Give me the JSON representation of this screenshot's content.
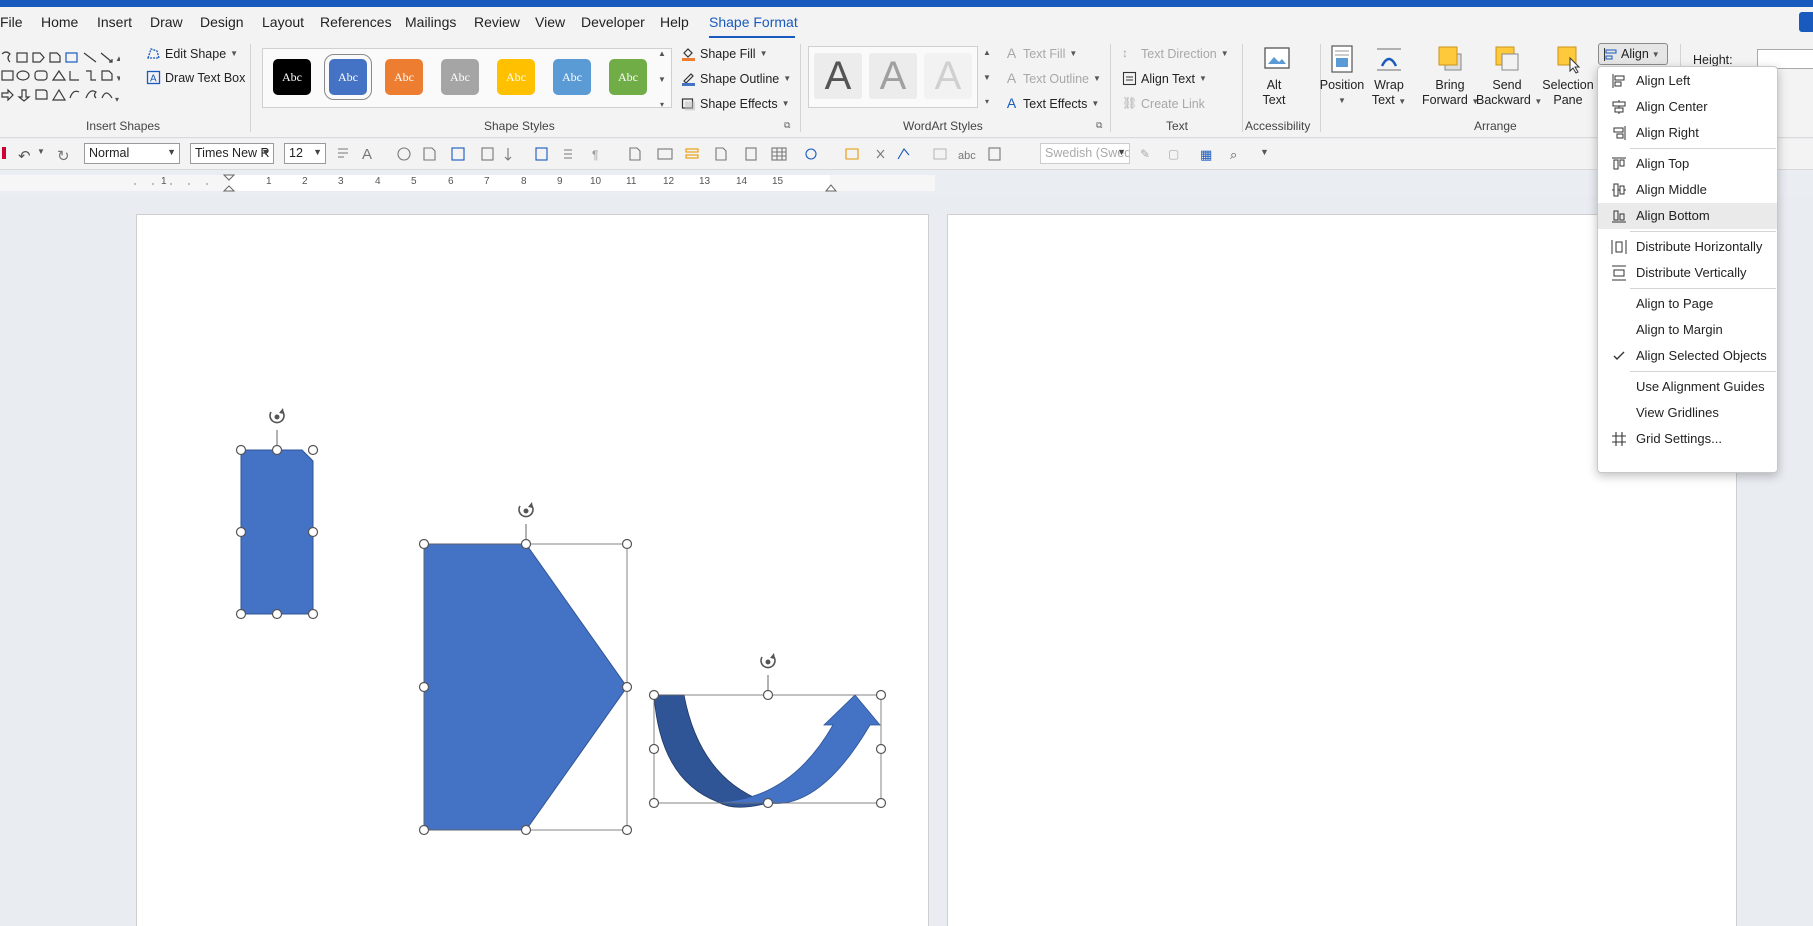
{
  "menu": {
    "tabs": [
      "File",
      "Home",
      "Insert",
      "Draw",
      "Design",
      "Layout",
      "References",
      "Mailings",
      "Review",
      "View",
      "Developer",
      "Help",
      "Shape Format"
    ],
    "active_tab": "Shape Format"
  },
  "ribbon": {
    "insert_shapes": {
      "label": "Insert Shapes",
      "edit_shape": "Edit Shape",
      "draw_text_box": "Draw Text Box"
    },
    "shape_styles": {
      "label": "Shape Styles",
      "swatch_text": "Abc",
      "swatch_colors": [
        "#000000",
        "#4472c4",
        "#ed7d31",
        "#a5a5a5",
        "#ffc000",
        "#5b9bd5",
        "#70ad47"
      ],
      "shape_fill": "Shape Fill",
      "shape_outline": "Shape Outline",
      "shape_effects": "Shape Effects"
    },
    "wordart_styles": {
      "label": "WordArt Styles",
      "letter": "A",
      "text_fill": "Text Fill",
      "text_outline": "Text Outline",
      "text_effects": "Text Effects"
    },
    "text": {
      "label": "Text",
      "text_direction": "Text Direction",
      "align_text": "Align Text",
      "create_link": "Create Link"
    },
    "accessibility": {
      "label": "Accessibility",
      "alt_text_1": "Alt",
      "alt_text_2": "Text"
    },
    "arrange": {
      "label": "Arrange",
      "position": "Position",
      "wrap_text_1": "Wrap",
      "wrap_text_2": "Text",
      "bring_forward_1": "Bring",
      "bring_forward_2": "Forward",
      "send_backward_1": "Send",
      "send_backward_2": "Backward",
      "selection_pane_1": "Selection",
      "selection_pane_2": "Pane",
      "align": "Align"
    },
    "size": {
      "height_label": "Height:"
    }
  },
  "qat": {
    "style_value": "Normal",
    "font_value": "Times New R",
    "size_value": "12",
    "language_value": "Swedish (Swed"
  },
  "ruler": {
    "numbers": [
      "1",
      "1",
      "2",
      "3",
      "4",
      "5",
      "6",
      "7",
      "8",
      "9",
      "10",
      "11",
      "12",
      "13",
      "14",
      "15"
    ]
  },
  "align_menu": {
    "items": [
      {
        "label": "Align Left",
        "icon": "align-left-icon"
      },
      {
        "label": "Align Center",
        "icon": "align-center-icon"
      },
      {
        "label": "Align Right",
        "icon": "align-right-icon"
      },
      {
        "label": "Align Top",
        "icon": "align-top-icon"
      },
      {
        "label": "Align Middle",
        "icon": "align-middle-icon"
      },
      {
        "label": "Align Bottom",
        "icon": "align-bottom-icon"
      },
      {
        "label": "Distribute Horizontally",
        "icon": "distribute-horizontal-icon"
      },
      {
        "label": "Distribute Vertically",
        "icon": "distribute-vertical-icon"
      },
      {
        "label": "Align to Page",
        "icon": ""
      },
      {
        "label": "Align to Margin",
        "icon": ""
      },
      {
        "label": "Align Selected Objects",
        "icon": "checkmark-icon",
        "checked": true
      },
      {
        "label": "Use Alignment Guides",
        "icon": ""
      },
      {
        "label": "View Gridlines",
        "icon": ""
      },
      {
        "label": "Grid Settings...",
        "icon": "grid-icon"
      }
    ],
    "hovered": "Align Bottom"
  },
  "colors": {
    "accent": "#185abd",
    "shape_fill": "#4472c4",
    "shape_dark": "#2f5597"
  }
}
